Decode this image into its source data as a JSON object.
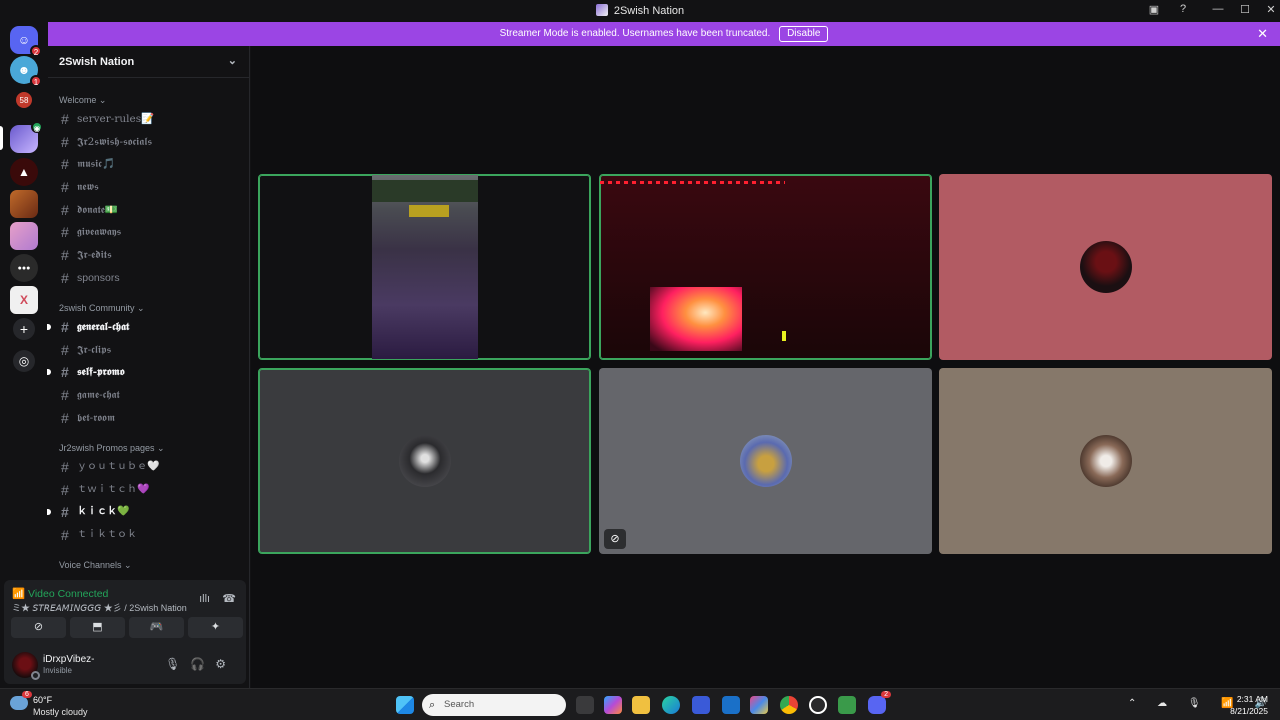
{
  "window": {
    "title": "2Swish Nation",
    "controls": [
      "inbox-icon",
      "help-icon",
      "minimize",
      "maximize",
      "close"
    ]
  },
  "banner": {
    "text": "Streamer Mode is enabled. Usernames have been truncated.",
    "button": "Disable",
    "close_glyph": "✕",
    "color": "#9b45e4"
  },
  "server_rail": [
    {
      "name": "discord-home",
      "badge": "2",
      "color": "#5865f2"
    },
    {
      "name": "server-smiley",
      "badge": "1",
      "color": "#4aa8d8"
    },
    {
      "name": "server-58",
      "glyph": "58",
      "color": "#c0392b"
    },
    {
      "name": "server-2swish",
      "badge_type": "voice",
      "color": "#6a5acd",
      "selected": true
    },
    {
      "name": "server-red",
      "color": "#3a0a0a"
    },
    {
      "name": "server-anime",
      "color": "#c06a2a"
    },
    {
      "name": "server-pink",
      "color": "#e6a0c8"
    },
    {
      "name": "server-colorful",
      "color": "#333333"
    },
    {
      "name": "server-x",
      "color": "#d04a5a"
    },
    {
      "name": "add-server",
      "glyph": "+"
    },
    {
      "name": "discover",
      "glyph": "◎"
    }
  ],
  "sidebar": {
    "server_name": "2Swish Nation",
    "categories": [
      {
        "name": "Welcome",
        "channels": [
          {
            "name": "server-rules📝",
            "unread": false
          },
          {
            "name": "𝕵𝖗2𝖘𝖜𝖎𝖘𝖍-𝖘𝖔𝖈𝖎𝖆𝖑𝖘",
            "unread": false
          },
          {
            "name": "𝖒𝖚𝖘𝖎𝖈🎵",
            "unread": false
          },
          {
            "name": "𝖓𝖊𝖜𝖘",
            "unread": false
          },
          {
            "name": "𝖉𝖔𝖓𝖆𝖙𝖊💵",
            "unread": false
          },
          {
            "name": "𝖌𝖎𝖛𝖊𝖆𝖜𝖆𝖞𝖘",
            "unread": false
          },
          {
            "name": "𝕵𝖗-𝖊𝖉𝖎𝖙𝖘",
            "unread": false
          },
          {
            "name": "sponsors",
            "unread": false
          }
        ]
      },
      {
        "name": "2swish Community",
        "channels": [
          {
            "name": "𝖌𝖊𝖓𝖊𝖗𝖆𝖑-𝖈𝖍𝖆𝖙",
            "unread": true
          },
          {
            "name": "𝕵𝖗-𝖈𝖑𝖎𝖕𝖘",
            "unread": false
          },
          {
            "name": "𝖘𝖊𝖑𝖋-𝖕𝖗𝖔𝖒𝖔",
            "unread": true
          },
          {
            "name": "𝖌𝖆𝖒𝖊-𝖈𝖍𝖆𝖙",
            "unread": false
          },
          {
            "name": "𝖇𝖊𝖙-𝖗𝖔𝖔𝖒",
            "unread": false
          }
        ]
      },
      {
        "name": "Jr2swish Promos pages",
        "channels": [
          {
            "name": "ｙｏｕｔｕｂｅ🤍",
            "unread": false
          },
          {
            "name": "ｔｗｉｔｃｈ💜",
            "unread": false
          },
          {
            "name": "ｋｉｃｋ💚",
            "unread": true
          },
          {
            "name": "ｔｉｋｔｏｋ",
            "unread": false
          }
        ]
      },
      {
        "name": "Voice Channels",
        "channels": []
      }
    ]
  },
  "voice_panel": {
    "status": "Video Connected",
    "channel": "ミ★ 𝘚𝘛𝘙𝘌𝘈𝘔𝘐𝘕𝘎𝘎𝘎 ★彡 / 2Swish Nation",
    "buttons": [
      "camera-off",
      "screen-share",
      "activities",
      "soundboard"
    ],
    "button_glyphs": [
      "⊘",
      "⬒",
      "🎮",
      "✦"
    ],
    "noise_glyph": "ıllı",
    "disconnect_glyph": "☎",
    "status_color": "#23a55a"
  },
  "user": {
    "name": "iDrxpVibez-",
    "status": "Invisible",
    "controls_glyphs": "🎙🎧⚙"
  },
  "video_grid": [
    {
      "name": "tile-stream-1",
      "type": "video",
      "bg": "#2a2a33",
      "speaking": true
    },
    {
      "name": "tile-stream-2",
      "type": "video",
      "bg": "#2a0b10",
      "speaking": true
    },
    {
      "name": "tile-avatar-1",
      "type": "avatar",
      "bg": "#b25b63",
      "avatar": "#1b0f12",
      "speaking": false
    },
    {
      "name": "tile-avatar-2",
      "type": "avatar",
      "bg": "#3a3b3e",
      "avatar": "#2b2b2e",
      "speaking": true
    },
    {
      "name": "tile-avatar-3",
      "type": "avatar",
      "bg": "#65666b",
      "avatar": "#c8a040",
      "speaking": false,
      "muted": true
    },
    {
      "name": "tile-avatar-4",
      "type": "avatar",
      "bg": "#86786a",
      "avatar": "#d8d0c8",
      "speaking": false
    }
  ],
  "taskbar": {
    "weather_temp": "60°F",
    "weather_cond": "Mostly cloudy",
    "weather_badge": "6",
    "search_placeholder": "Search",
    "tray_glyphs": "⌃ ☁ 🎙 📶 🔊",
    "time": "2:31 AM",
    "date": "8/21/2025",
    "discord_badge": "2"
  }
}
